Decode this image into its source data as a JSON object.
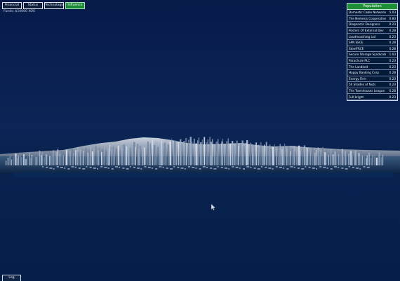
{
  "tabs": [
    {
      "label": "Financial"
    },
    {
      "label": "Status"
    },
    {
      "label": "Technology"
    },
    {
      "label": "Influence"
    }
  ],
  "funds": "Funds: $10000 XOS",
  "population": {
    "title": "Population",
    "rows": [
      {
        "name": "Domestic Cable Networks",
        "value": "5.03"
      },
      {
        "name": "The Nemesis Cooperative",
        "value": "0.83"
      },
      {
        "name": "Diagnostic Designers",
        "value": "0.23"
      },
      {
        "name": "Posters Of External Dev",
        "value": "0.28"
      },
      {
        "name": "Loudmouthing Ltd",
        "value": "0.23"
      },
      {
        "name": "SPN SECE",
        "value": "0.28"
      },
      {
        "name": "SteelFRCE",
        "value": "0.28"
      },
      {
        "name": "Secure Storage Syndicate",
        "value": "1.03"
      },
      {
        "name": "Parachute PLC",
        "value": "0.23"
      },
      {
        "name": "The Landlord",
        "value": "0.23"
      },
      {
        "name": "Happy Banking Corp",
        "value": "0.28"
      },
      {
        "name": "Energy Firm",
        "value": "0.23"
      },
      {
        "name": "50 Shades of Nuts",
        "value": "0.23"
      },
      {
        "name": "The Townhouses League",
        "value": "0.28"
      },
      {
        "name": "Full bright",
        "value": "0.23"
      }
    ]
  },
  "log_button": "Log",
  "icons": {
    "cursor": "cursor-icon"
  },
  "colors": {
    "sky": "#0b2556",
    "water": "#041f4a",
    "tab_active": "#1a8a35",
    "panel_header": "#1f8e38"
  }
}
